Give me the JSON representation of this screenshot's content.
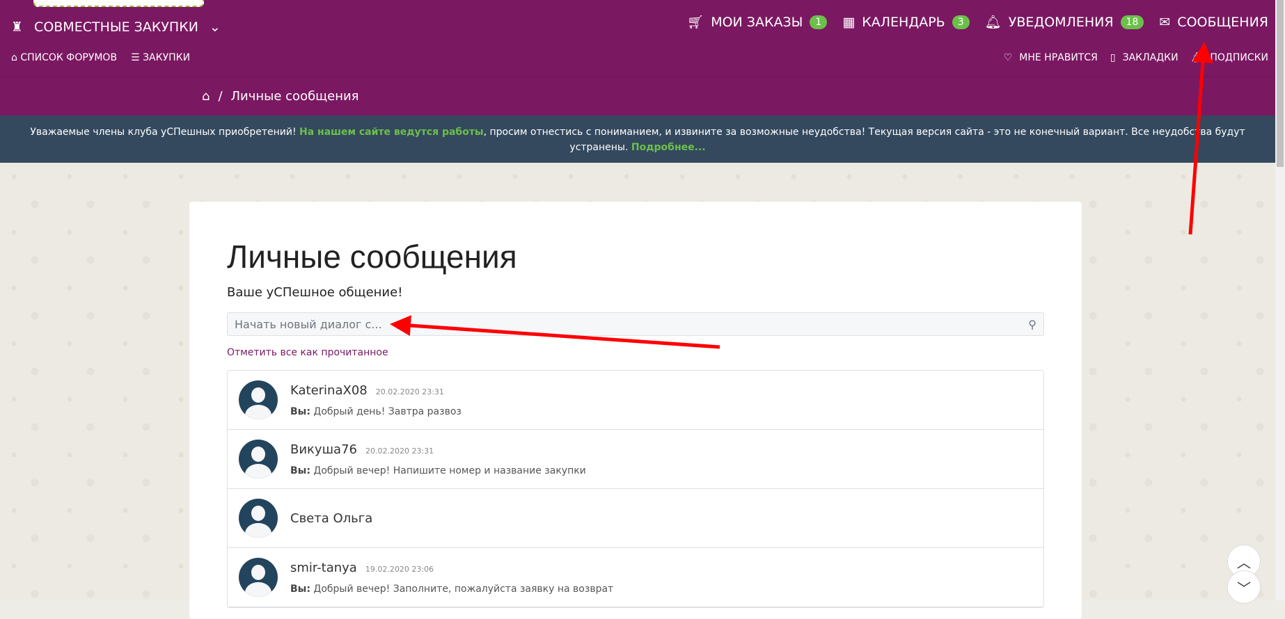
{
  "header": {
    "section": "СОВМЕСТНЫЕ ЗАКУПКИ",
    "forums": "СПИСОК ФОРУМОВ",
    "purchases": "ЗАКУПКИ",
    "orders": "МОИ ЗАКАЗЫ",
    "orders_count": "1",
    "calendar": "КАЛЕНДАРЬ",
    "calendar_count": "3",
    "notifications": "УВЕДОМЛЕНИЯ",
    "notifications_count": "18",
    "messages": "СООБЩЕНИЯ",
    "likes": "МНЕ НРАВИТСЯ",
    "bookmarks": "ЗАКЛАДКИ",
    "subscriptions": "ПОДПИСКИ"
  },
  "breadcrumb": {
    "sep": "/",
    "current": "Личные сообщения"
  },
  "banner": {
    "text1": "Уважаемые члены клуба уСПешных приобретений! ",
    "highlight": "На нашем сайте ведутся работы",
    "text2": ", просим отнестись с пониманием, и извините за возможные неудобства! Текущая версия сайта - это не конечный вариант. Все неудобства будут устранены. ",
    "more": "Подробнее..."
  },
  "main": {
    "title": "Личные сообщения",
    "subtitle": "Ваше уСПешное общение!",
    "search_placeholder": "Начать новый диалог с...",
    "mark_all": "Отметить все как прочитанное",
    "dialogs": [
      {
        "name": "KaterinaX08",
        "date": "20.02.2020 23:31",
        "prefix": "Вы:",
        "message": "Добрый день! Завтра развоз"
      },
      {
        "name": "Викуша76",
        "date": "20.02.2020 23:31",
        "prefix": "Вы:",
        "message": "Добрый вечер! Напишите номер и название закупки"
      },
      {
        "name": "Света Ольга",
        "date": "",
        "prefix": "",
        "message": ""
      },
      {
        "name": "smir-tanya",
        "date": "19.02.2020 23:06",
        "prefix": "Вы:",
        "message": "Добрый вечер! Заполните, пожалуйста заявку на возврат"
      }
    ]
  }
}
